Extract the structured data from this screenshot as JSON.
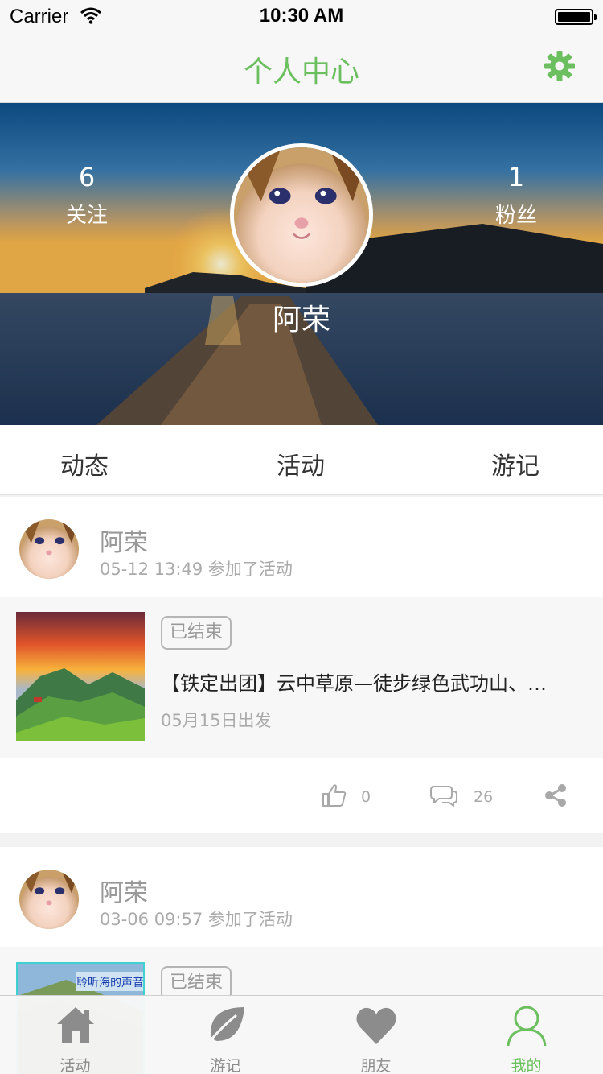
{
  "status": {
    "carrier": "Carrier",
    "time": "10:30 AM"
  },
  "nav": {
    "title": "个人中心",
    "title_color": "#6cbf5f",
    "right_icon": "gear-icon"
  },
  "profile": {
    "name": "阿荣",
    "following": {
      "count": "6",
      "label": "关注"
    },
    "fans": {
      "count": "1",
      "label": "粉丝"
    }
  },
  "tabs": [
    "动态",
    "活动",
    "游记"
  ],
  "feed": [
    {
      "user": "阿荣",
      "meta": "05-12 13:49 参加了活动",
      "activity": {
        "status": "已结束",
        "title": "【铁定出团】云中草原—徒步绿色武功山、…",
        "date": "05月15日出发"
      },
      "likes": "0",
      "comments": "26"
    },
    {
      "user": "阿荣",
      "meta": "03-06 09:57 参加了活动",
      "activity": {
        "status": "已结束",
        "thumb_caption": "聆听海的声音"
      }
    }
  ],
  "tabbar": [
    {
      "label": "活动",
      "icon": "home-icon"
    },
    {
      "label": "游记",
      "icon": "leaf-icon"
    },
    {
      "label": "朋友",
      "icon": "heart-icon"
    },
    {
      "label": "我的",
      "icon": "person-icon",
      "active": true
    }
  ]
}
